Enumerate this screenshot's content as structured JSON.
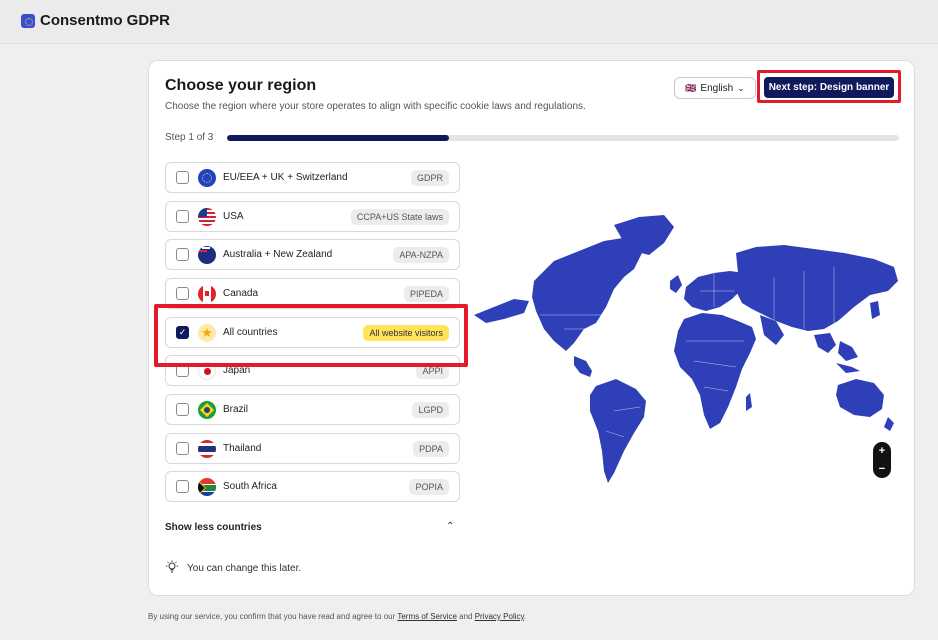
{
  "app": {
    "title": "Consentmo GDPR"
  },
  "page": {
    "title": "Choose your region",
    "subtitle": "Choose the region where your store operates to align with specific cookie laws and regulations.",
    "language": "English",
    "language_flag": "🇬🇧",
    "next_button": "Next step: Design banner",
    "step_label": "Step 1 of 3",
    "progress": 0.33,
    "highlight_color": "#e11a2c",
    "accent_color": "#0f1a5c"
  },
  "regions": [
    {
      "name": "EU/EEA + UK + Switzerland",
      "badge": "GDPR",
      "checked": false,
      "flag": "eu-flag-icon"
    },
    {
      "name": "USA",
      "badge": "CCPA+US State laws",
      "checked": false,
      "flag": "us-flag-icon"
    },
    {
      "name": "Australia + New Zealand",
      "badge": "APA-NZPA",
      "checked": false,
      "flag": "au-flag-icon"
    },
    {
      "name": "Canada",
      "badge": "PIPEDA",
      "checked": false,
      "flag": "ca-flag-icon"
    },
    {
      "name": "All countries",
      "badge": "All website visitors",
      "checked": true,
      "flag": "star-icon"
    },
    {
      "name": "Japan",
      "badge": "APPI",
      "checked": false,
      "flag": "jp-flag-icon"
    },
    {
      "name": "Brazil",
      "badge": "LGPD",
      "checked": false,
      "flag": "br-flag-icon"
    },
    {
      "name": "Thailand",
      "badge": "PDPA",
      "checked": false,
      "flag": "th-flag-icon"
    },
    {
      "name": "South Africa",
      "badge": "POPIA",
      "checked": false,
      "flag": "za-flag-icon"
    }
  ],
  "show_less": "Show less countries",
  "tip": "You can change this later.",
  "map": {
    "color": "#2f3fb8",
    "zoom_in": "+",
    "zoom_out": "−"
  },
  "footer": {
    "text_before": "By using our service, you confirm that you have read and agree to our ",
    "terms": "Terms of Service",
    "and": " and ",
    "privacy": "Privacy Policy",
    "end": "."
  }
}
